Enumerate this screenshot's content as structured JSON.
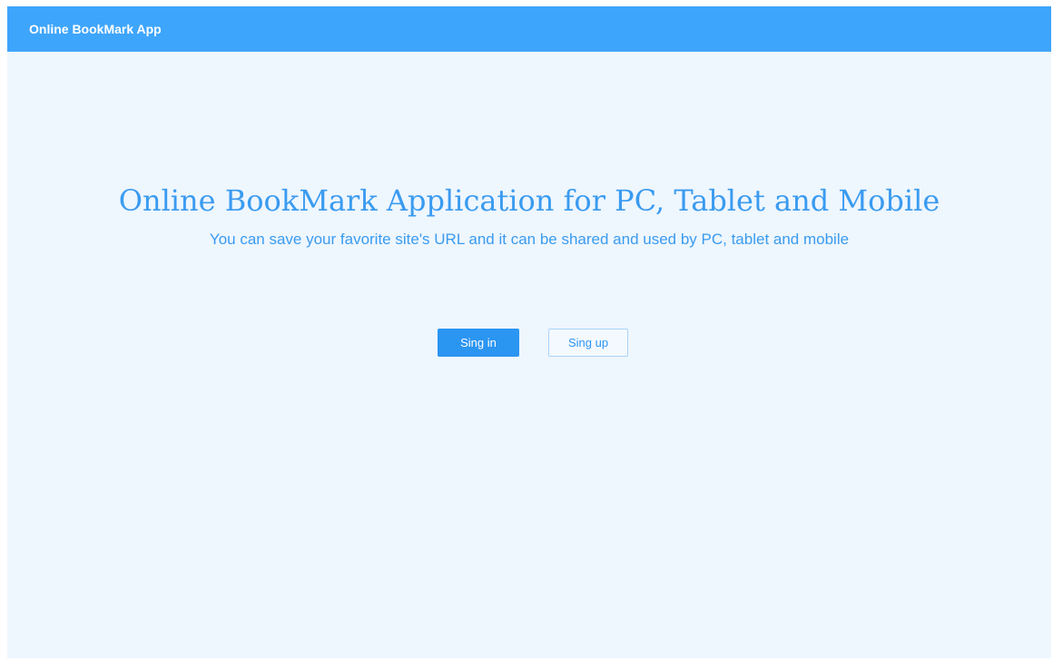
{
  "header": {
    "brand": "Online BookMark App"
  },
  "hero": {
    "title": "Online BookMark Application for PC, Tablet and Mobile",
    "subtitle": "You can save your favorite site's URL and it can be shared and used by PC, tablet and mobile"
  },
  "actions": {
    "sign_in_label": "Sing in",
    "sign_up_label": "Sing up"
  },
  "colors": {
    "header_bg": "#3ea5fc",
    "page_bg": "#eef6fe",
    "accent": "#2b95f2"
  }
}
